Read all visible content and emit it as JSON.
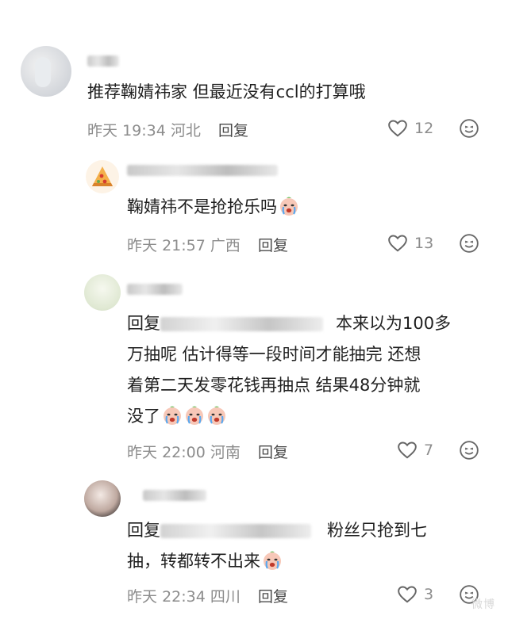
{
  "comments": [
    {
      "body": "推荐鞠婧祎家 但最近没有ccl的打算哦",
      "date": "昨天",
      "time": "19:34",
      "location": "河北",
      "reply_label": "回复",
      "likes": "12",
      "avatar_icon": "photo-avatar"
    },
    {
      "body": "鞠婧祎不是抢抢乐吗",
      "date": "昨天",
      "time": "21:57",
      "location": "广西",
      "reply_label": "回复",
      "likes": "13",
      "avatar_icon": "pizza-avatar"
    },
    {
      "reply_prefix": "回复",
      "body_line1_tail": "本来以为100多",
      "body_line2": "万抽呢 估计得等一段时间才能抽完 还想",
      "body_line3": "着第二天发零花钱再抽点 结果48分钟就",
      "body_line4": "没了",
      "date": "昨天",
      "time": "22:00",
      "location": "河南",
      "reply_label": "回复",
      "likes": "7",
      "avatar_icon": "photo-avatar"
    },
    {
      "reply_prefix": "回复",
      "body_line1_tail": "粉丝只抢到七",
      "body_line2": "抽，转都转不出来",
      "date": "昨天",
      "time": "22:34",
      "location": "四川",
      "reply_label": "回复",
      "likes": "3",
      "avatar_icon": "photo-avatar"
    }
  ],
  "icons": {
    "like": "heart-outline-icon",
    "emoji": "smile-face-icon",
    "crying": "crying-emoji"
  },
  "watermark": "微博"
}
